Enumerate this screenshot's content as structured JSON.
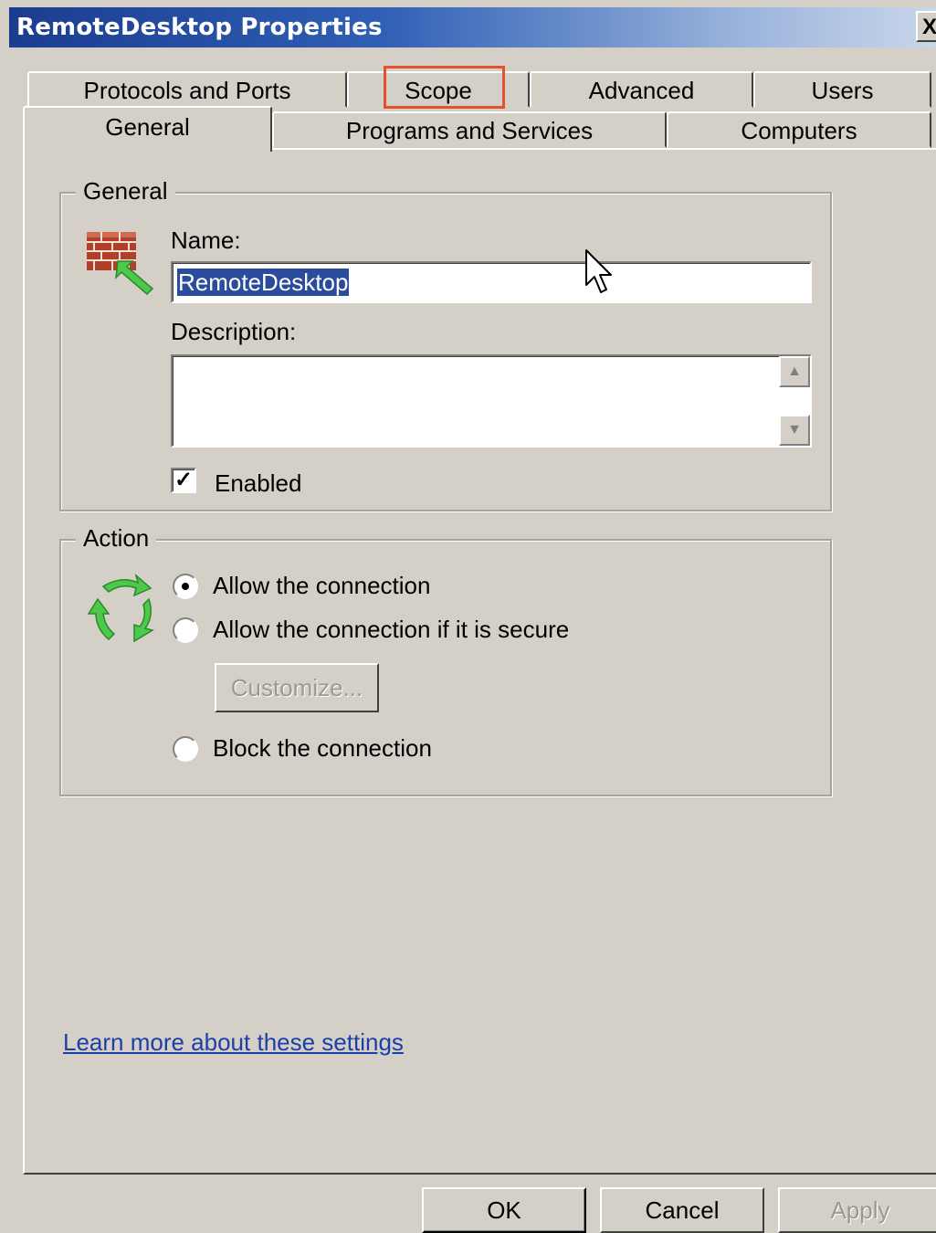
{
  "window": {
    "title": "RemoteDesktop Properties",
    "close_glyph": "X"
  },
  "tabs": {
    "row1": [
      {
        "label": "Protocols and Ports"
      },
      {
        "label": "Scope"
      },
      {
        "label": "Advanced"
      },
      {
        "label": "Users"
      }
    ],
    "row2": [
      {
        "label": "General",
        "active": true
      },
      {
        "label": "Programs and Services"
      },
      {
        "label": "Computers"
      }
    ],
    "highlighted_tab": "Scope",
    "highlight_color": "#e4512d"
  },
  "general": {
    "legend": "General",
    "icon": "firewall-rule-icon",
    "name_label": "Name:",
    "name_value": "RemoteDesktop",
    "description_label": "Description:",
    "description_value": "",
    "enabled_label": "Enabled",
    "enabled_checked": true
  },
  "action": {
    "legend": "Action",
    "icon": "action-arrows-icon",
    "options": [
      {
        "label": "Allow the connection",
        "selected": true
      },
      {
        "label": "Allow the connection if it is secure",
        "selected": false
      },
      {
        "label": "Block the connection",
        "selected": false
      }
    ],
    "customize_label": "Customize..."
  },
  "link_text": "Learn more about these settings",
  "footer": {
    "ok_label": "OK",
    "cancel_label": "Cancel",
    "apply_label": "Apply"
  },
  "colors": {
    "window_bg": "#d4d0c8",
    "title_bar": "#1b3d8f",
    "selection": "#2b4c9b",
    "link": "#1c3fa8"
  }
}
